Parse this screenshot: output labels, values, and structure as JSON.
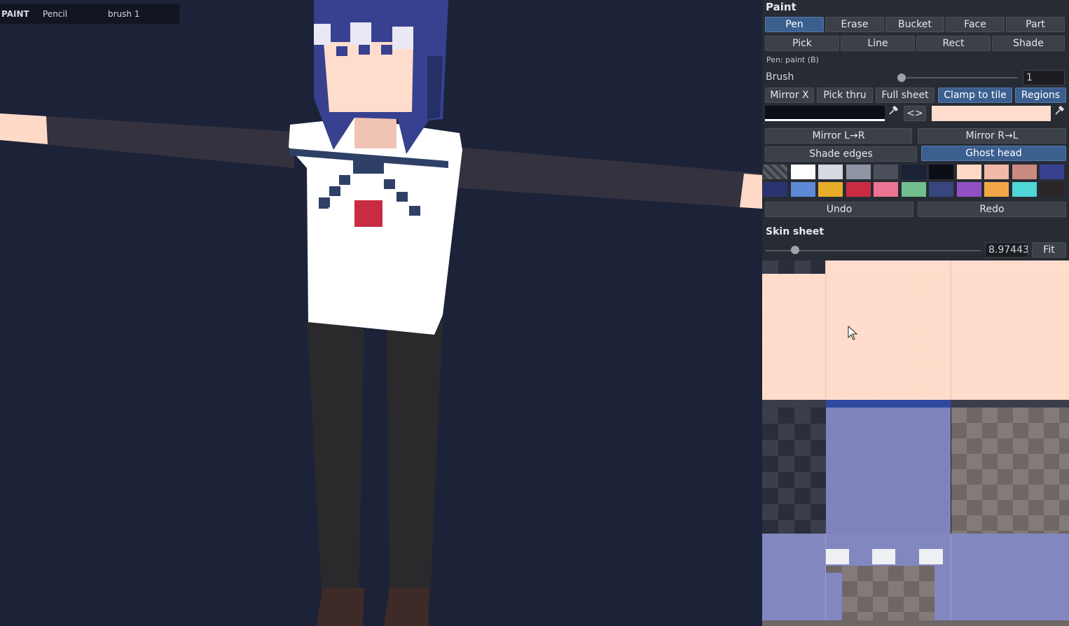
{
  "status": {
    "mode": "PAINT",
    "tool": "Pencil",
    "brush": "brush 1"
  },
  "panel": {
    "title": "Paint",
    "tools_row1": [
      "Pen",
      "Erase",
      "Bucket",
      "Face",
      "Part"
    ],
    "tools_row2": [
      "Pick",
      "Line",
      "Rect",
      "Shade"
    ],
    "active_tool": "Pen",
    "tool_hint": "Pen: paint (B)",
    "brush_label": "Brush",
    "brush_value": "1",
    "options": [
      "Mirror X",
      "Pick thru",
      "Full sheet",
      "Clamp to tile",
      "Regions"
    ],
    "active_options": [
      "Clamp to tile",
      "Regions"
    ],
    "swap_label": "<>",
    "primary_color": "#0c0e17",
    "secondary_color": "#ffddcc",
    "mirror_lr": "Mirror L→R",
    "mirror_rl": "Mirror R→L",
    "shade_edges": "Shade edges",
    "ghost_head": "Ghost head",
    "palette_row1": [
      "#ffffff",
      "#d5d9e0",
      "#8f95a3",
      "#4b505c",
      "#1b2235",
      "#0b0d17",
      "#ffd9c8",
      "#efbba8",
      "#c98a82",
      "#38418f"
    ],
    "palette_row2": [
      "#2b3470",
      "#5c8ad6",
      "#e6ac2a",
      "#c92c42",
      "#ec7493",
      "#72be8f",
      "#37467e",
      "#9150c4",
      "#f5a748",
      "#4fd6d6"
    ],
    "undo": "Undo",
    "redo": "Redo",
    "sheet_title": "Skin sheet",
    "zoom_value": "8.97443",
    "fit": "Fit"
  }
}
